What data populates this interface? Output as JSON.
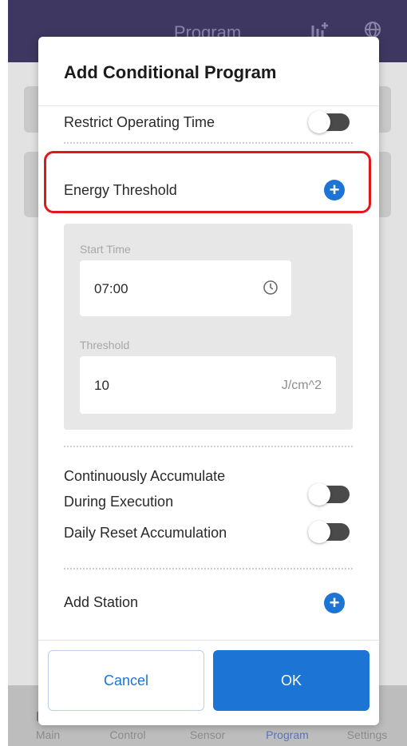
{
  "appbar": {
    "title": "Program",
    "icons": [
      "add-chart-icon",
      "globe-icon"
    ]
  },
  "tabbar": {
    "tabs": [
      {
        "label": "Main",
        "icon": "home-icon"
      },
      {
        "label": "Control",
        "icon": "control-icon"
      },
      {
        "label": "Sensor",
        "icon": "sensor-icon"
      },
      {
        "label": "Program",
        "icon": "program-icon",
        "active": true
      },
      {
        "label": "Settings",
        "icon": "settings-icon"
      }
    ]
  },
  "modal": {
    "title": "Add Conditional Program",
    "restrict_operating_time": {
      "label": "Restrict Operating Time",
      "enabled": false
    },
    "energy_threshold": {
      "label": "Energy Threshold",
      "add_icon": "plus-circle-icon"
    },
    "start_time": {
      "label": "Start Time",
      "value": "07:00",
      "icon": "clock-icon"
    },
    "threshold": {
      "label": "Threshold",
      "value": "10",
      "unit": "J/cm^2"
    },
    "continuous_accumulate": {
      "label_line1": "Continuously Accumulate",
      "label_line2": "During Execution",
      "enabled": false
    },
    "daily_reset": {
      "label": "Daily Reset Accumulation",
      "enabled": false
    },
    "add_station": {
      "label": "Add Station",
      "add_icon": "plus-circle-icon"
    },
    "buttons": {
      "cancel": "Cancel",
      "ok": "OK"
    }
  },
  "colors": {
    "accent": "#1c74d4",
    "highlight": "#e0181c",
    "appbar": "#3e3761"
  }
}
